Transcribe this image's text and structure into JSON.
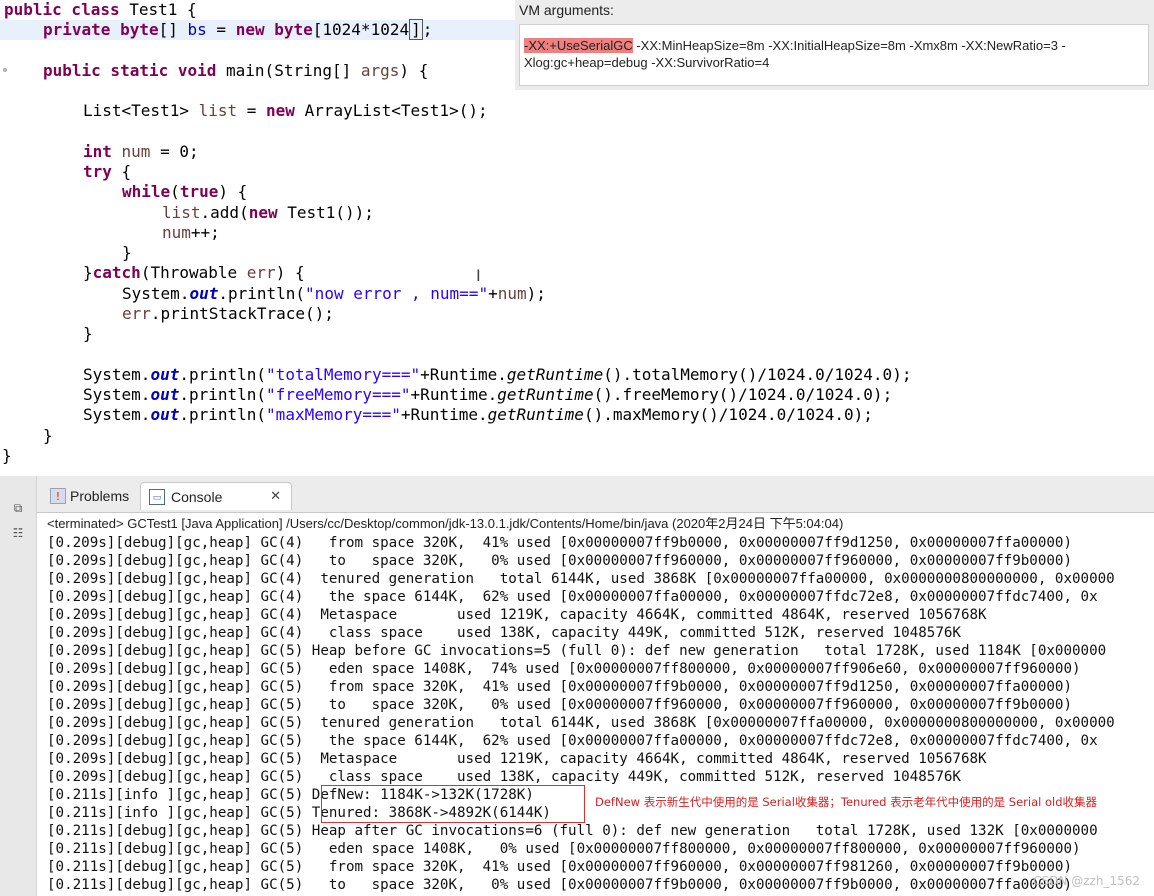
{
  "editor": {
    "lines": {
      "l1a": "public class",
      "l1b": " Test1 {",
      "l2a": "private",
      "l2b": "byte",
      "l2c": "[] ",
      "l2d": "bs",
      "l2e": " = ",
      "l2f": "new",
      "l2g": "byte",
      "l2h": "[1024*1024",
      "l2i": "]",
      "l2j": ";",
      "l3a": "public static void",
      "l3b": " main(String[] ",
      "l3c": "args",
      "l3d": ") {",
      "l4a": "List<Test1> ",
      "l4b": "list",
      "l4c": " = ",
      "l4d": "new",
      "l4e": " ArrayList<Test1>();",
      "l5a": "int",
      "l5b": " num",
      "l5c": " = 0;",
      "l6a": "try",
      "l6b": " {",
      "l7a": "while",
      "l7b": "(",
      "l7c": "true",
      "l7d": ") {",
      "l8a": "list",
      "l8b": ".add(",
      "l8c": "new",
      "l8d": " Test1());",
      "l9a": "num",
      "l9b": "++;",
      "l10": "}",
      "l11a": "}",
      "l11b": "catch",
      "l11c": "(Throwable ",
      "l11d": "err",
      "l11e": ") {",
      "l12a": "System.",
      "l12b": "out",
      "l12c": ".println(",
      "l12d": "\"now error , num==\"",
      "l12e": "+",
      "l12f": "num",
      "l12g": ");",
      "l13a": "err",
      "l13b": ".printStackTrace();",
      "l14": "}",
      "l15a": "System.",
      "l15b": "out",
      "l15c": ".println(",
      "l15d": "\"totalMemory===\"",
      "l15e": "+Runtime.",
      "l15f": "getRuntime",
      "l15g": "().totalMemory()/1024.0/1024.0);",
      "l16a": "System.",
      "l16b": "out",
      "l16c": ".println(",
      "l16d": "\"freeMemory===\"",
      "l16e": "+Runtime.",
      "l16f": "getRuntime",
      "l16g": "().freeMemory()/1024.0/1024.0);",
      "l17a": "System.",
      "l17b": "out",
      "l17c": ".println(",
      "l17d": "\"maxMemory===\"",
      "l17e": "+Runtime.",
      "l17f": "getRuntime",
      "l17g": "().maxMemory()/1024.0/1024.0);",
      "l18": "}",
      "l19": "}"
    },
    "text_cursor_glyph": "I"
  },
  "vm_args": {
    "title": "VM arguments:",
    "highlighted": "-XX:+UseSerialGC",
    "rest_line1": " -XX:MinHeapSize=8m -XX:InitialHeapSize=8m -Xmx8m -XX:NewRatio=3 -",
    "line2": "Xlog:gc+heap=debug -XX:SurvivorRatio=4"
  },
  "console": {
    "tabs": {
      "problems": "Problems",
      "console": "Console",
      "problems_icon_glyph": "!",
      "console_icon_glyph": "▭",
      "close_glyph": "✕"
    },
    "side_icons": [
      "⧉",
      "☷"
    ],
    "header": "<terminated> GCTest1 [Java Application] /Users/cc/Desktop/common/jdk-13.0.1.jdk/Contents/Home/bin/java (2020年2月24日 下午5:04:04)",
    "output_lines": [
      "[0.209s][debug][gc,heap] GC(4)   from space 320K,  41% used [0x00000007ff9b0000, 0x00000007ff9d1250, 0x00000007ffa00000)",
      "[0.209s][debug][gc,heap] GC(4)   to   space 320K,   0% used [0x00000007ff960000, 0x00000007ff960000, 0x00000007ff9b0000)",
      "[0.209s][debug][gc,heap] GC(4)  tenured generation   total 6144K, used 3868K [0x00000007ffa00000, 0x0000000800000000, 0x00000",
      "[0.209s][debug][gc,heap] GC(4)   the space 6144K,  62% used [0x00000007ffa00000, 0x00000007ffdc72e8, 0x00000007ffdc7400, 0x",
      "[0.209s][debug][gc,heap] GC(4)  Metaspace       used 1219K, capacity 4664K, committed 4864K, reserved 1056768K",
      "[0.209s][debug][gc,heap] GC(4)   class space    used 138K, capacity 449K, committed 512K, reserved 1048576K",
      "[0.209s][debug][gc,heap] GC(5) Heap before GC invocations=5 (full 0): def new generation   total 1728K, used 1184K [0x000000",
      "[0.209s][debug][gc,heap] GC(5)   eden space 1408K,  74% used [0x00000007ff800000, 0x00000007ff906e60, 0x00000007ff960000)",
      "[0.209s][debug][gc,heap] GC(5)   from space 320K,  41% used [0x00000007ff9b0000, 0x00000007ff9d1250, 0x00000007ffa00000)",
      "[0.209s][debug][gc,heap] GC(5)   to   space 320K,   0% used [0x00000007ff960000, 0x00000007ff960000, 0x00000007ff9b0000)",
      "[0.209s][debug][gc,heap] GC(5)  tenured generation   total 6144K, used 3868K [0x00000007ffa00000, 0x0000000800000000, 0x00000",
      "[0.209s][debug][gc,heap] GC(5)   the space 6144K,  62% used [0x00000007ffa00000, 0x00000007ffdc72e8, 0x00000007ffdc7400, 0x",
      "[0.209s][debug][gc,heap] GC(5)  Metaspace       used 1219K, capacity 4664K, committed 4864K, reserved 1056768K",
      "[0.209s][debug][gc,heap] GC(5)   class space    used 138K, capacity 449K, committed 512K, reserved 1048576K",
      "[0.211s][info ][gc,heap] GC(5) DefNew: 1184K->132K(1728K)",
      "[0.211s][info ][gc,heap] GC(5) Tenured: 3868K->4892K(6144K)",
      "[0.211s][debug][gc,heap] GC(5) Heap after GC invocations=6 (full 0): def new generation   total 1728K, used 132K [0x0000000",
      "[0.211s][debug][gc,heap] GC(5)   eden space 1408K,   0% used [0x00000007ff800000, 0x00000007ff800000, 0x00000007ff960000)",
      "[0.211s][debug][gc,heap] GC(5)   from space 320K,  41% used [0x00000007ff960000, 0x00000007ff981260, 0x00000007ff9b0000)",
      "[0.211s][debug][gc,heap] GC(5)   to   space 320K,   0% used [0x00000007ff9b0000, 0x00000007ff9b0000, 0x00000007ffa00000)"
    ],
    "annotation": "DefNew 表示新生代中使用的是 Serial收集器；Tenured 表示老年代中使用的是 Serial old收集器",
    "watermark": "CSDN @zzh_1562"
  }
}
